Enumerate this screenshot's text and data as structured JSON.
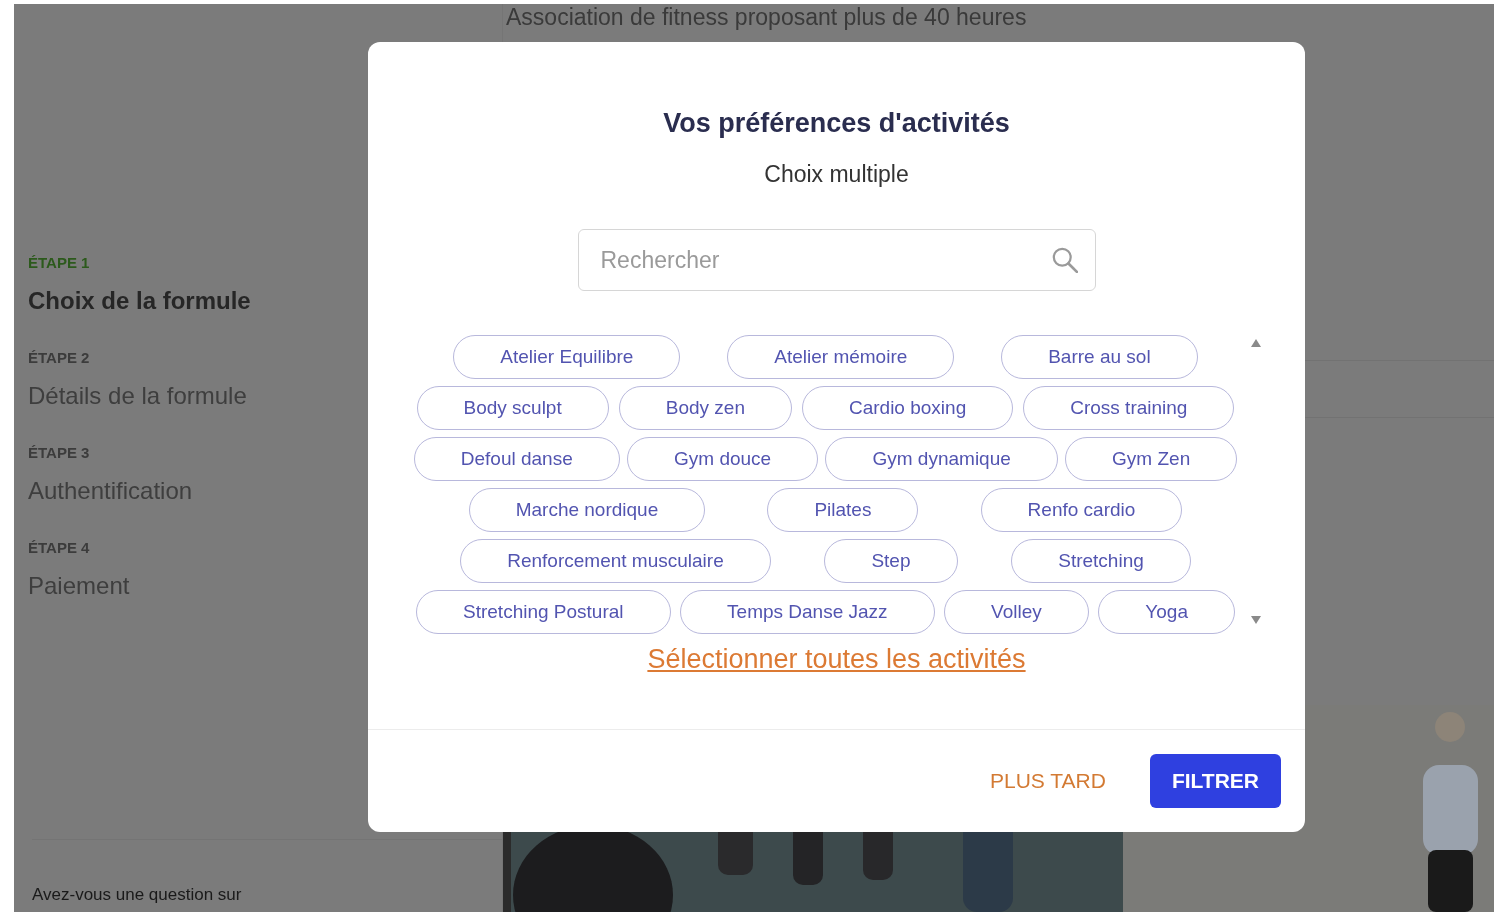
{
  "page": {
    "intro_text": "Association de fitness proposant plus de 40 heures",
    "footer_text": "Avez-vous une question sur"
  },
  "steps": [
    {
      "label": "ÉTAPE 1",
      "title": "Choix de la formule",
      "selected": true
    },
    {
      "label": "ÉTAPE 2",
      "title": "Détails de la formule",
      "selected": false
    },
    {
      "label": "ÉTAPE 3",
      "title": "Authentification",
      "selected": false
    },
    {
      "label": "ÉTAPE 4",
      "title": "Paiement",
      "selected": false
    }
  ],
  "modal": {
    "title": "Vos préférences d'activités",
    "subtitle": "Choix multiple",
    "search": {
      "placeholder": "Rechercher"
    },
    "activities": [
      {
        "label": "Atelier Equilibre",
        "selected": false
      },
      {
        "label": "Atelier mémoire",
        "selected": false
      },
      {
        "label": "Barre au sol",
        "selected": false
      },
      {
        "label": "Body sculpt",
        "selected": false
      },
      {
        "label": "Body zen",
        "selected": false
      },
      {
        "label": "Cardio boxing",
        "selected": false
      },
      {
        "label": "Cross training",
        "selected": false
      },
      {
        "label": "Defoul danse",
        "selected": false
      },
      {
        "label": "Gym douce",
        "selected": false
      },
      {
        "label": "Gym dynamique",
        "selected": false
      },
      {
        "label": "Gym Zen",
        "selected": false
      },
      {
        "label": "Marche nordique",
        "selected": false
      },
      {
        "label": "Pilates",
        "selected": false
      },
      {
        "label": "Renfo cardio",
        "selected": false
      },
      {
        "label": "Renforcement musculaire",
        "selected": false
      },
      {
        "label": "Step",
        "selected": false
      },
      {
        "label": "Stretching",
        "selected": false
      },
      {
        "label": "Stretching Postural",
        "selected": false
      },
      {
        "label": "Temps Danse Jazz",
        "selected": false
      },
      {
        "label": "Volley",
        "selected": false
      },
      {
        "label": "Yoga",
        "selected": false
      }
    ],
    "select_all_link": "Sélectionner toutes les activités",
    "buttons": [
      {
        "label": "PLUS TARD",
        "kind": "text"
      },
      {
        "label": "FILTRER",
        "kind": "primary"
      }
    ]
  }
}
